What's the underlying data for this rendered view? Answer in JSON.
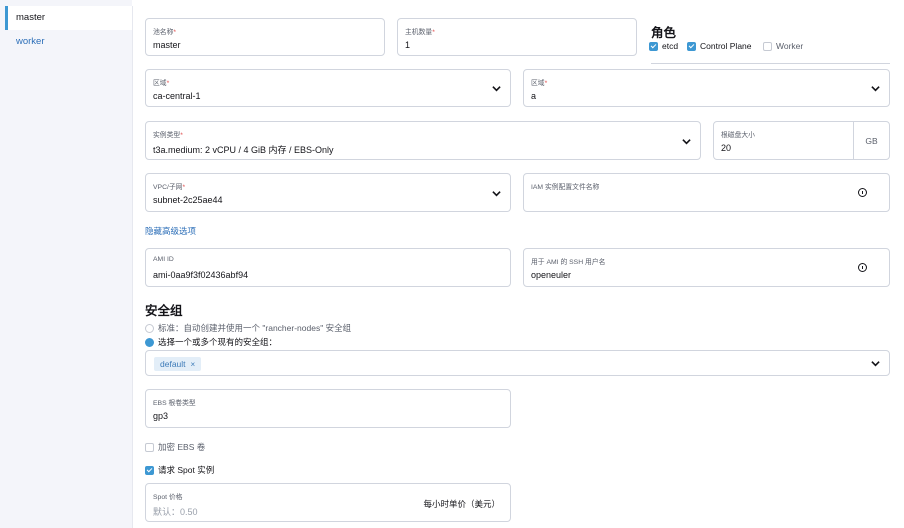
{
  "sidebar": {
    "items": [
      {
        "label": "master",
        "active": true
      },
      {
        "label": "worker",
        "active": false
      }
    ]
  },
  "pool": {
    "name_label": "池名称",
    "name_value": "master",
    "count_label": "主机数量",
    "count_value": "1"
  },
  "roles": {
    "title": "角色",
    "etcd": "etcd",
    "control_plane": "Control Plane",
    "worker": "Worker"
  },
  "region": {
    "label": "区域",
    "value": "ca-central-1"
  },
  "zone": {
    "label": "区域",
    "value": "a"
  },
  "instance": {
    "label": "实例类型",
    "value": "t3a.medium: 2 vCPU / 4 GiB 内存 / EBS-Only"
  },
  "disk": {
    "label": "根磁盘大小",
    "value": "20",
    "unit": "GB"
  },
  "vpc": {
    "label": "VPC/子网",
    "value": "subnet-2c25ae44"
  },
  "iam": {
    "label": "IAM 实例配置文件名称",
    "value": ""
  },
  "advanced_link": "隐藏高级选项",
  "ami": {
    "label": "AMI ID",
    "value": "ami-0aa9f3f02436abf94"
  },
  "ssh_user": {
    "label": "用于 AMI 的 SSH 用户名",
    "value": "openeuler"
  },
  "security": {
    "title": "安全组",
    "standard": "标准：自动创建并使用一个 \"rancher-nodes\" 安全组",
    "existing": "选择一个或多个现有的安全组：",
    "tags": [
      "default"
    ],
    "tag_remove": "×"
  },
  "ebs": {
    "label": "EBS 根卷类型",
    "value": "gp3"
  },
  "encrypt": "加密 EBS 卷",
  "spot": {
    "request": "请求 Spot 实例",
    "price_label": "Spot 价格",
    "price_placeholder": "默认：0.50",
    "price_suffix": "每小时单价（美元）"
  },
  "required_mark": "*",
  "colors": {
    "accent": "#3d98d3",
    "link": "#2d6fb8",
    "required": "#e04848"
  }
}
